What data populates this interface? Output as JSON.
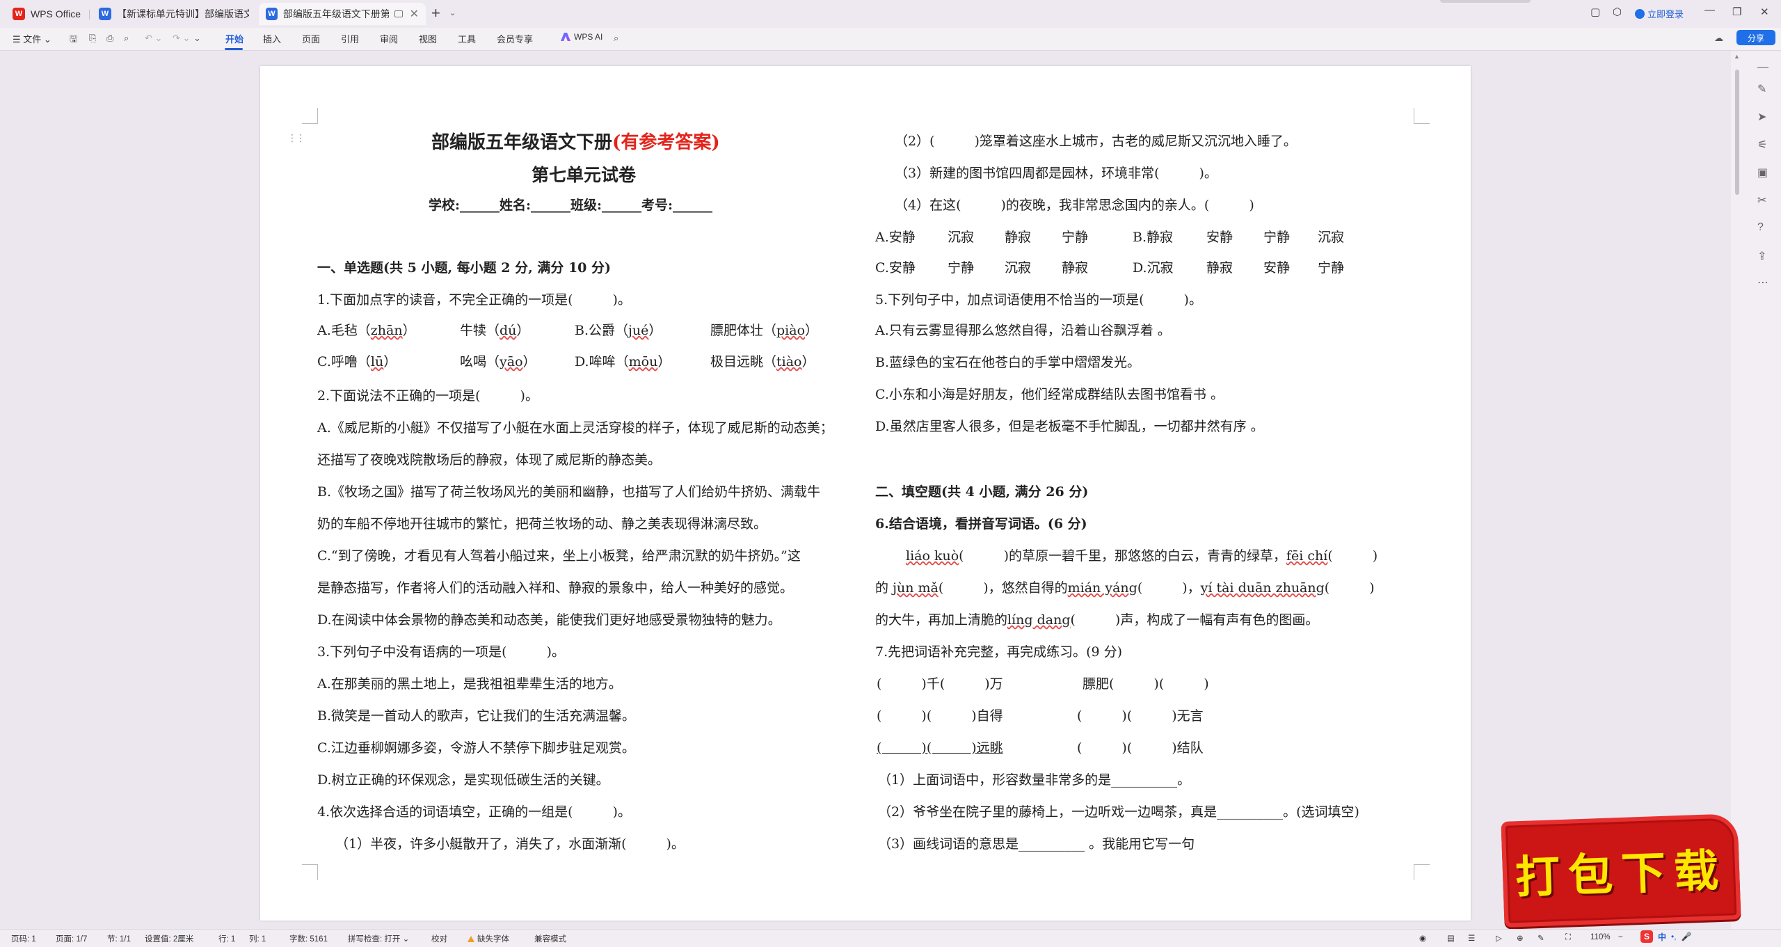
{
  "titlebar": {
    "tabs": [
      {
        "label": "WPS Office",
        "icon": "wps-logo-icon"
      },
      {
        "label": "【新课标单元特训】部编版语文五年",
        "icon": "word-doc-icon"
      },
      {
        "label": "部编版五年级语文下册第七单",
        "icon": "word-doc-icon"
      }
    ],
    "login_label": "立即登录"
  },
  "toolbar": {
    "file_label": "文件",
    "menus": [
      "开始",
      "插入",
      "页面",
      "引用",
      "审阅",
      "视图",
      "工具",
      "会员专享"
    ],
    "wps_ai_label": "WPS AI",
    "share_label": "分享"
  },
  "document": {
    "left": {
      "title_main": "部编版五年级语文下册",
      "title_red": "(有参考答案)",
      "subtitle": "第七单元试卷",
      "info_line": "学校:______姓名:______班级:______考号:______",
      "section1_heading": "一、单选题(共 5 小题, 每小题 2 分, 满分 10 分)",
      "q1": "1.下面加点字的读音，不完全正确的一项是(　　　)。",
      "q1_a": [
        "A.毛毡（",
        "zhān",
        "）",
        "牛犊（",
        "dú",
        "）",
        "B.公爵（",
        "jué",
        "）",
        "膘肥体壮（",
        "piào",
        "）"
      ],
      "q1_c": [
        "C.呼噜（",
        "lū",
        "）",
        "吆喝（",
        "yāo",
        "）",
        "D.哞哞（",
        "mōu",
        "）",
        "极目远眺（",
        "tiào",
        "）"
      ],
      "q2": "2.下面说法不正确的一项是(　　　)。",
      "q2_a1": "A.《威尼斯的小艇》不仅描写了小艇在水面上灵活穿梭的样子，体现了威尼斯的动态美；",
      "q2_a2": "还描写了夜晚戏院散场后的静寂，体现了威尼斯的静态美。",
      "q2_b1": "B.《牧场之国》描写了荷兰牧场风光的美丽和幽静，也描写了人们给奶牛挤奶、满载牛",
      "q2_b2": "奶的车船不停地开往城市的繁忙，把荷兰牧场的动、静之美表现得淋漓尽致。",
      "q2_c1": "C.“到了傍晚，才看见有人驾着小船过来，坐上小板凳，给严肃沉默的奶牛挤奶。”这",
      "q2_c2": "是静态描写，作者将人们的活动融入祥和、静寂的景象中，给人一种美好的感觉。",
      "q2_d": "D.在阅读中体会景物的静态美和动态美，能使我们更好地感受景物独特的魅力。",
      "q3": "3.下列句子中没有语病的一项是(　　　)。",
      "q3_a": "A.在那美丽的黑土地上，是我祖祖辈辈生活的地方。",
      "q3_b": "B.微笑是一首动人的歌声，它让我们的生活充满温馨。",
      "q3_c": "C.江边垂柳婀娜多姿，令游人不禁停下脚步驻足观赏。",
      "q3_d": "D.树立正确的环保观念，是实现低碳生活的关键。",
      "q4": "4.依次选择合适的词语填空，正确的一组是(　　　)。",
      "q4_1": "（1）半夜，许多小艇散开了，消失了，水面渐渐(　　　)。"
    },
    "right": {
      "q4_2": "（2）(　　　)笼罩着这座水上城市，古老的威尼斯又沉沉地入睡了。",
      "q4_3": "（3）新建的图书馆四周都是园林，环境非常(　　　)。",
      "q4_4": "（4）在这(　　　)的夜晚，我非常思念国内的亲人。(　　　)",
      "q4_ab": [
        "A.安静",
        "沉寂",
        "静寂",
        "宁静",
        "B.静寂",
        "安静",
        "宁静",
        "沉寂"
      ],
      "q4_cd": [
        "C.安静",
        "宁静",
        "沉寂",
        "静寂",
        "D.沉寂",
        "静寂",
        "安静",
        "宁静"
      ],
      "q5": "5.下列句子中，加点词语使用不恰当的一项是(　　　)。",
      "q5_a": "A.只有云雾显得那么悠然自得，沿着山谷飘浮着 。",
      "q5_b": "B.蓝绿色的宝石在他苍白的手掌中熠熠发光。",
      "q5_c": "C.小东和小海是好朋友，他们经常成群结队去图书馆看书 。",
      "q5_d": "D.虽然店里客人很多，但是老板毫不手忙脚乱，一切都井然有序 。",
      "section2_heading": "二、填空题(共 4 小题, 满分 26 分)",
      "q6": "6.结合语境，看拼音写词语。(6 分)",
      "q6_l1": [
        "liáo kuò",
        "(　　　)的草原一碧千里，那悠悠的白云，青青的绿草，",
        "fēi chí",
        "(　　　)"
      ],
      "q6_l2": [
        "的",
        "jùn mǎ",
        "(　　　)，悠然自得的",
        "mián yáng",
        "(　　　)，",
        "yí tài duān zhuāng",
        "(　　　)"
      ],
      "q6_l3": [
        "的大牛，再加上清脆的",
        "líng dang",
        "(　　　)声，构成了一幅有声有色的图画。"
      ],
      "q7": "7.先把词语补充完整，再完成练习。(9 分)",
      "q7_r1": [
        "(　　　)千(　　　)万",
        "膘肥(　　　)(　　　)"
      ],
      "q7_r2": [
        "(　　　)(　　　)自得",
        "(　　　)(　　　)无言"
      ],
      "q7_r3": [
        "(　　　)(　　　)远眺",
        "(　　　)(　　　)结队"
      ],
      "q7_1": "（1）上面词语中，形容数量非常多的是__________。",
      "q7_2": "（2）爷爷坐在院子里的藤椅上，一边听戏一边喝茶，真是__________。(选词填空)",
      "q7_3": "（3）画线词语的意思是__________ 。我能用它写一句"
    }
  },
  "statusbar": {
    "page_num": "页码: 1",
    "pages": "页面: 1/7",
    "section": "节: 1/1",
    "setting": "设置值: 2厘米",
    "row": "行: 1",
    "col": "列: 1",
    "words": "字数: 5161",
    "spell": "拼写检查: 打开",
    "proof": "校对",
    "missing_font": "缺失字体",
    "compat": "兼容模式",
    "zoom": "110%"
  },
  "banner": {
    "label": "打包下载"
  },
  "ime": {
    "items": [
      "中",
      "•,",
      "🎤"
    ]
  }
}
